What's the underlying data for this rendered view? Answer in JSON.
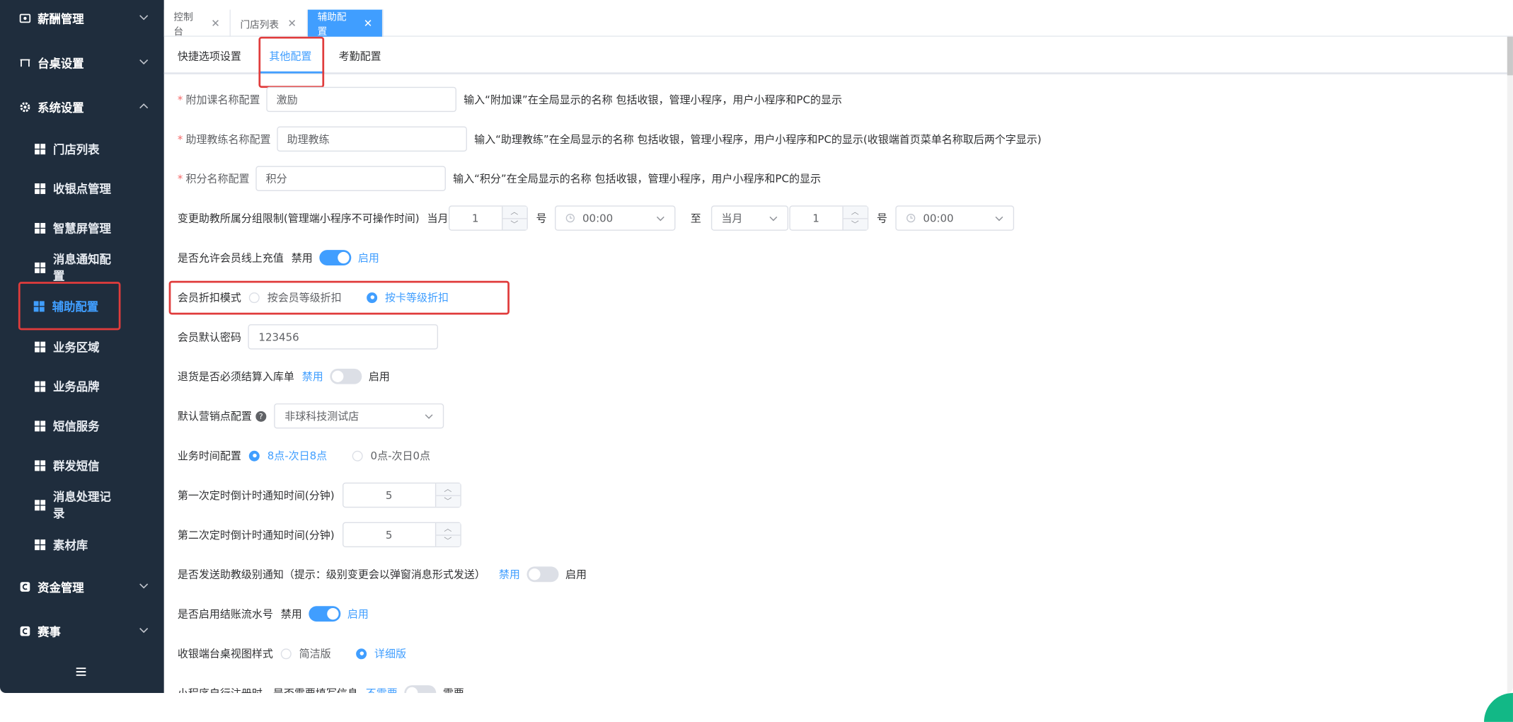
{
  "sidebar": {
    "groups": [
      {
        "label": "薪酬管理",
        "icon": "salary-icon"
      },
      {
        "label": "台桌设置",
        "icon": "table-icon"
      },
      {
        "label": "系统设置",
        "icon": "gear-icon"
      },
      {
        "label": "资金管理",
        "icon": "funds-icon"
      },
      {
        "label": "赛事",
        "icon": "event-icon"
      }
    ],
    "items": [
      {
        "label": "门店列表"
      },
      {
        "label": "收银点管理"
      },
      {
        "label": "智慧屏管理"
      },
      {
        "label": "消息通知配置"
      },
      {
        "label": "辅助配置"
      },
      {
        "label": "业务区域"
      },
      {
        "label": "业务品牌"
      },
      {
        "label": "短信服务"
      },
      {
        "label": "群发短信"
      },
      {
        "label": "消息处理记录"
      },
      {
        "label": "素材库"
      }
    ],
    "collapse_icon": "hamburger-icon"
  },
  "tabs": [
    {
      "label": "控制台"
    },
    {
      "label": "门店列表"
    },
    {
      "label": "辅助配置"
    }
  ],
  "subtabs": [
    {
      "label": "快捷选项设置"
    },
    {
      "label": "其他配置"
    },
    {
      "label": "考勤配置"
    }
  ],
  "form": {
    "addon_name": {
      "label": "附加课名称配置",
      "value": "激励",
      "hint": "输入“附加课”在全局显示的名称 包括收银，管理小程序，用户小程序和PC的显示"
    },
    "assistant_name": {
      "label": "助理教练名称配置",
      "value": "助理教练",
      "hint": "输入“助理教练”在全局显示的名称 包括收银，管理小程序，用户小程序和PC的显示(收银端首页菜单名称取后两个字显示)"
    },
    "points_name": {
      "label": "积分名称配置",
      "value": "积分",
      "hint": "输入“积分”在全局显示的名称 包括收银，管理小程序，用户小程序和PC的显示"
    },
    "group_change": {
      "label": "变更助教所属分组限制(管理端小程序不可操作时间)",
      "prefix": "当月",
      "day1": "1",
      "hao1": "号",
      "time1": "00:00",
      "to": "至",
      "month2": "当月",
      "day2": "1",
      "hao2": "号",
      "time2": "00:00"
    },
    "online_recharge": {
      "label": "是否允许会员线上充值",
      "off": "禁用",
      "on": "启用",
      "value": true
    },
    "discount_mode": {
      "label": "会员折扣模式",
      "opt1": "按会员等级折扣",
      "opt2": "按卡等级折扣",
      "selected": 2
    },
    "default_password": {
      "label": "会员默认密码",
      "value": "123456"
    },
    "return_settle": {
      "label": "退货是否必须结算入库单",
      "off": "禁用",
      "on": "启用",
      "value": false
    },
    "default_shop": {
      "label": "默认营销点配置",
      "value": "非球科技测试店"
    },
    "business_time": {
      "label": "业务时间配置",
      "opt1": "8点-次日8点",
      "opt2": "0点-次日0点",
      "selected": 1
    },
    "first_notice": {
      "label": "第一次定时倒计时通知时间(分钟)",
      "value": "5"
    },
    "second_notice": {
      "label": "第二次定时倒计时通知时间(分钟)",
      "value": "5"
    },
    "level_notice": {
      "label": "是否发送助教级别通知（提示：级别变更会以弹窗消息形式发送）",
      "off": "禁用",
      "on": "启用",
      "value": false
    },
    "settle_serial": {
      "label": "是否启用结账流水号",
      "off": "禁用",
      "on": "启用",
      "value": true
    },
    "view_style": {
      "label": "收银端台桌视图样式",
      "opt1": "简洁版",
      "opt2": "详细版",
      "selected": 2
    },
    "mini_register": {
      "label": "小程序自行注册时，是否需要填写信息",
      "off": "不需要",
      "on": "需要",
      "value": false
    }
  },
  "colors": {
    "accent": "#409eff",
    "sidebar_bg": "#1f2d3d",
    "highlight": "#e03c3c"
  }
}
